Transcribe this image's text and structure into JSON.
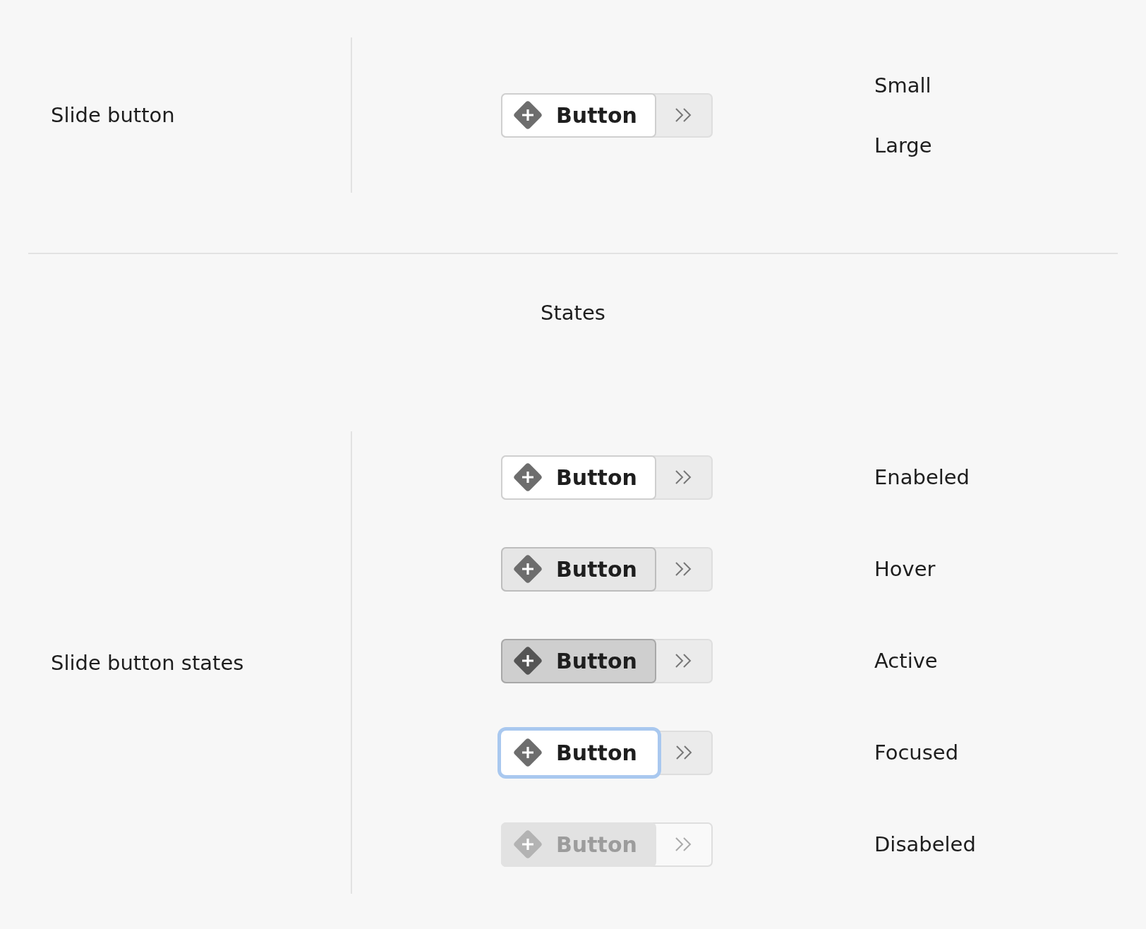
{
  "overview": {
    "label": "Slide button",
    "button": {
      "label": "Button",
      "kind": "enabled"
    },
    "sizes": [
      "Small",
      "Large"
    ]
  },
  "states_heading": "States",
  "states": {
    "label": "Slide button states",
    "rows": [
      {
        "kind": "enabled",
        "button_label": "Button",
        "state_label": "Enabeled"
      },
      {
        "kind": "hover",
        "button_label": "Button",
        "state_label": "Hover"
      },
      {
        "kind": "active",
        "button_label": "Button",
        "state_label": "Active"
      },
      {
        "kind": "focused",
        "button_label": "Button",
        "state_label": "Focused"
      },
      {
        "kind": "disabled",
        "button_label": "Button",
        "state_label": "Disabeled"
      }
    ]
  }
}
